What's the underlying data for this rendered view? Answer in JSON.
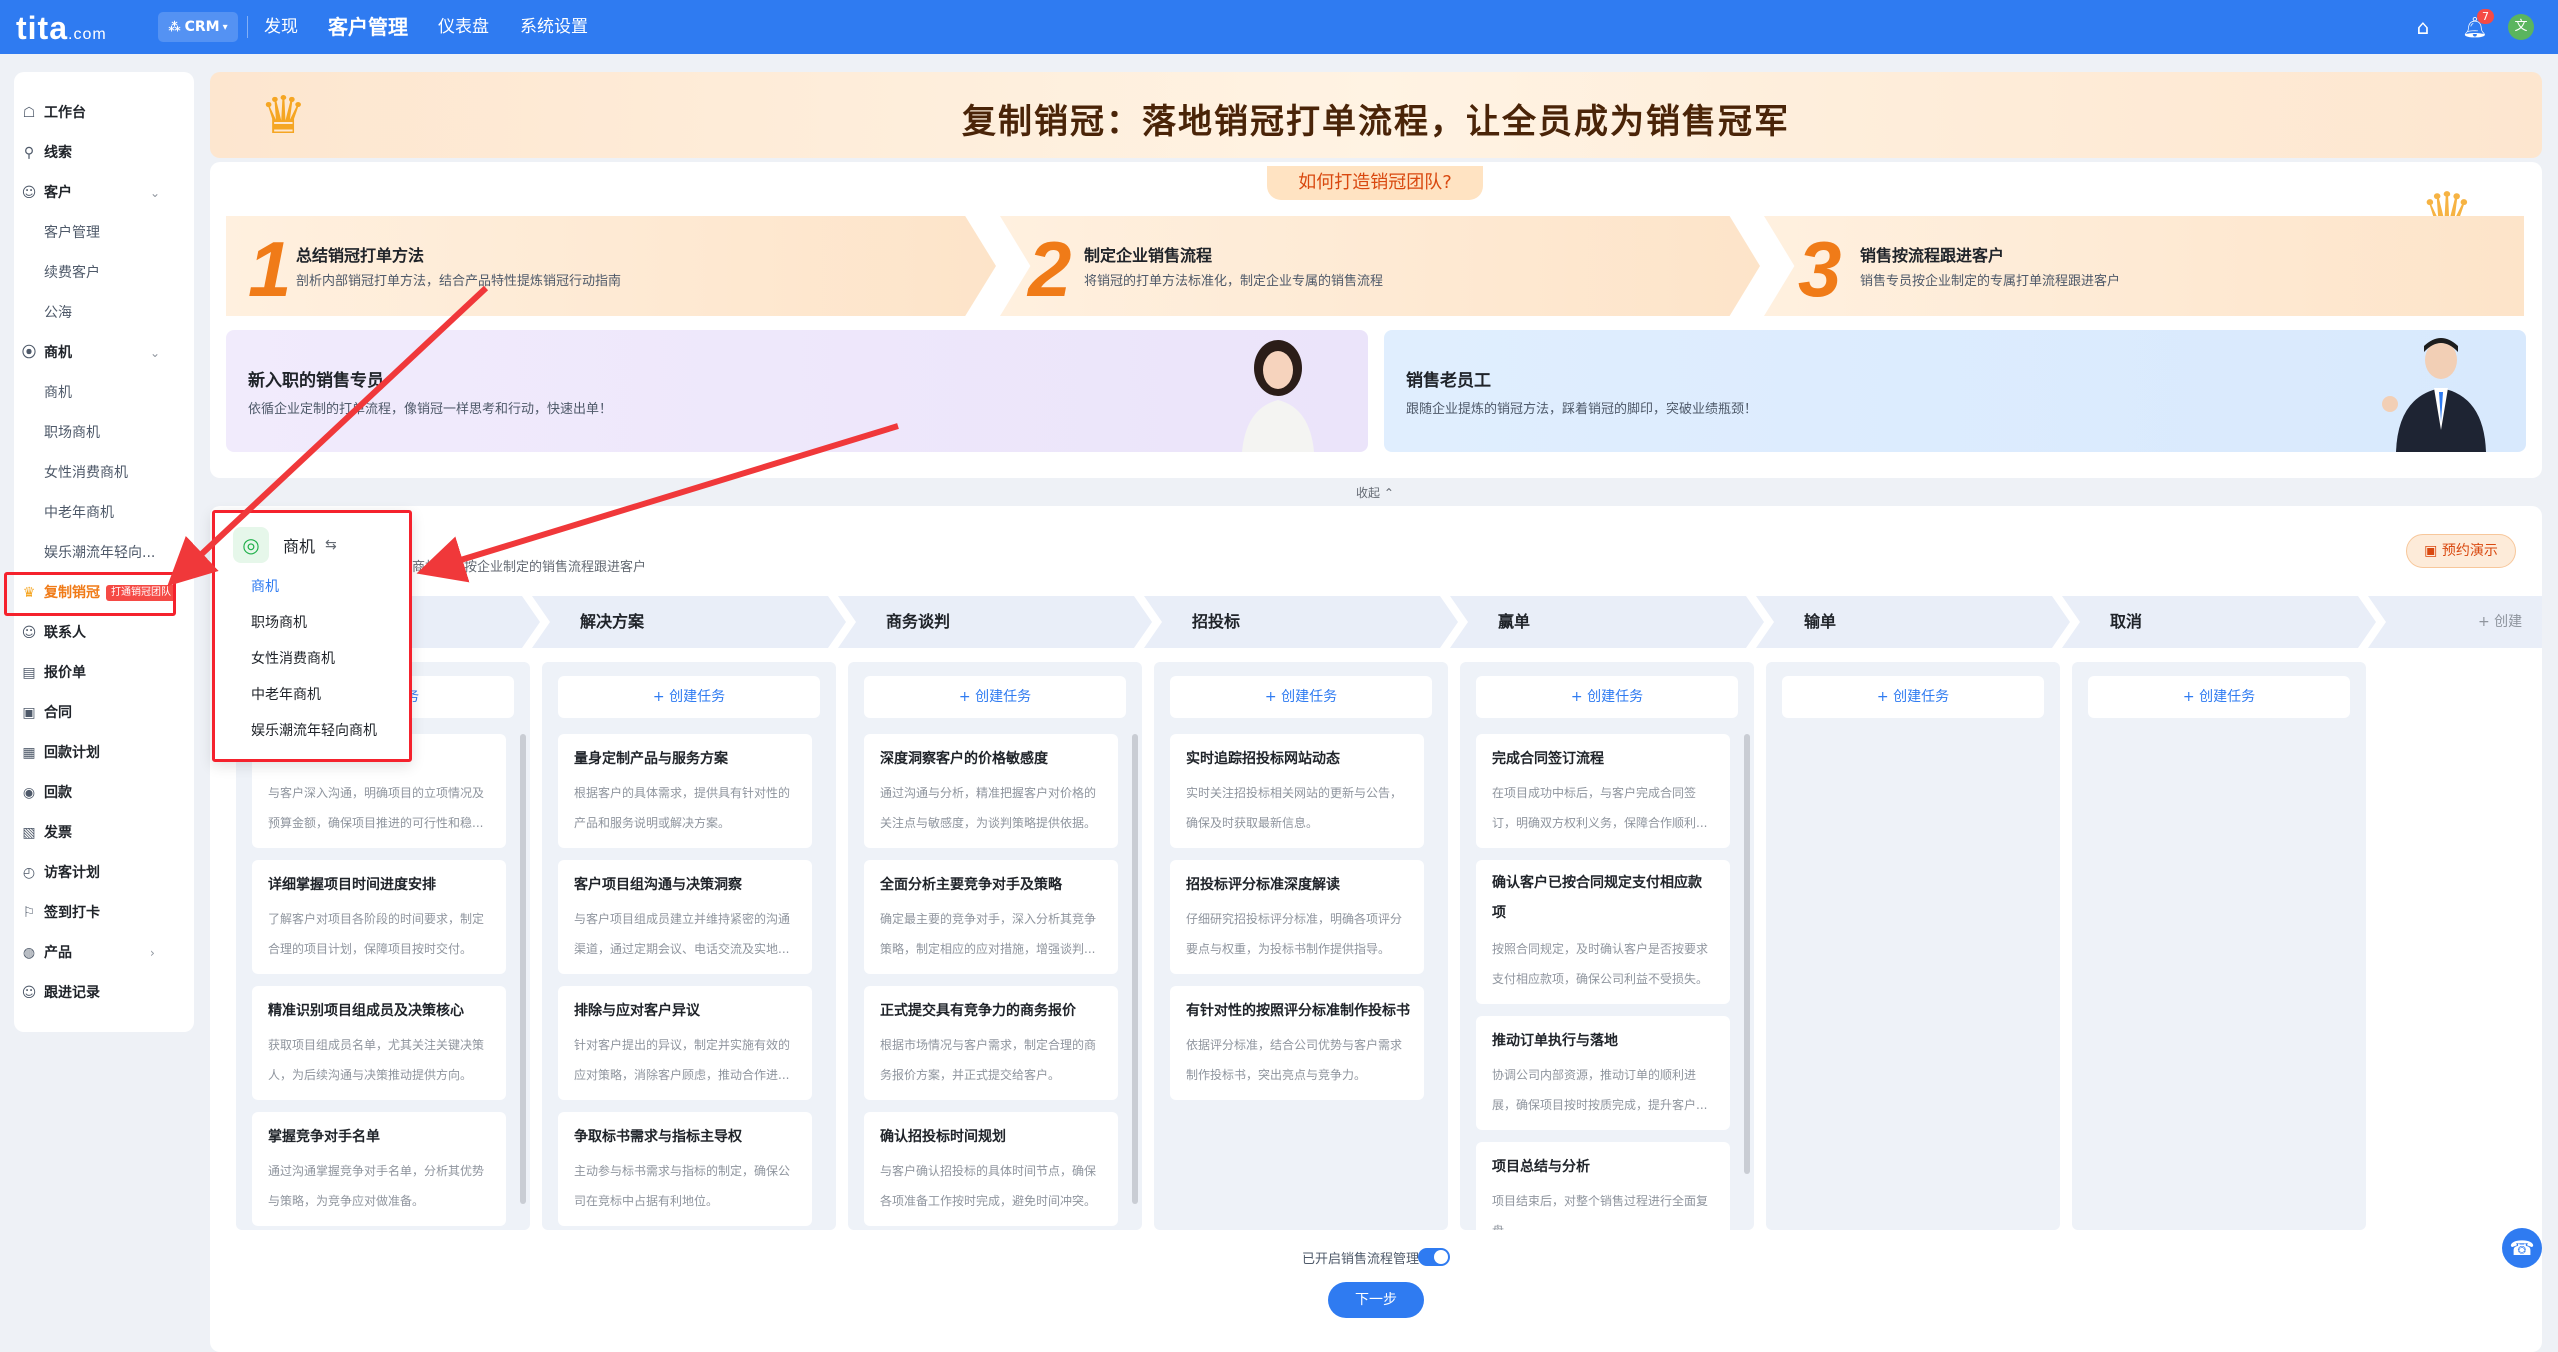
{
  "topbar": {
    "logo": "tita",
    "logo_suffix": ".com",
    "crm_label": "CRM",
    "nav": [
      "发现",
      "客户管理",
      "仪表盘",
      "系统设置"
    ],
    "notification_count": "7",
    "avatar_initial": "文"
  },
  "sidebar": {
    "items": [
      {
        "label": "工作台",
        "icon": "workbench-icon"
      },
      {
        "label": "线索",
        "icon": "leads-icon"
      },
      {
        "label": "客户",
        "icon": "customer-icon"
      },
      {
        "label": "客户管理"
      },
      {
        "label": "续费客户"
      },
      {
        "label": "公海"
      },
      {
        "label": "商机",
        "icon": "opportunity-icon"
      },
      {
        "label": "商机"
      },
      {
        "label": "职场商机"
      },
      {
        "label": "女性消费商机"
      },
      {
        "label": "中老年商机"
      },
      {
        "label": "娱乐潮流年轻向..."
      },
      {
        "label": "复制销冠",
        "tag": "打通销冠团队"
      },
      {
        "label": "联系人"
      },
      {
        "label": "报价单"
      },
      {
        "label": "合同"
      },
      {
        "label": "回款计划"
      },
      {
        "label": "回款"
      },
      {
        "label": "发票"
      },
      {
        "label": "访客计划"
      },
      {
        "label": "签到打卡"
      },
      {
        "label": "产品"
      },
      {
        "label": "跟进记录"
      }
    ]
  },
  "banner": {
    "title": "复制销冠：落地销冠打单流程，让全员成为销售冠军"
  },
  "intro": {
    "tag": "如何打造销冠团队?",
    "steps": [
      {
        "num": "1",
        "title": "总结销冠打单方法",
        "desc": "剖析内部销冠打单方法，结合产品特性提炼销冠行动指南"
      },
      {
        "num": "2",
        "title": "制定企业销售流程",
        "desc": "将销冠的打单方法标准化，制定企业专属的销售流程"
      },
      {
        "num": "3",
        "title": "销售按流程跟进客户",
        "desc": "销售专员按企业制定的专属打单流程跟进客户"
      }
    ],
    "cards": [
      {
        "title": "新入职的销售专员",
        "desc": "依循企业定制的打单流程，像销冠一样思考和行动，快速出单！"
      },
      {
        "title": "销售老员工",
        "desc": "跟随企业提炼的销冠方法，踩着销冠的脚印，突破业绩瓶颈！"
      }
    ],
    "collapse": "收起"
  },
  "pipeline": {
    "sub_desc": "商机时，按企业制定的销售流程跟进客户",
    "demo_button": "预约演示",
    "create_label": "+ 创建任务",
    "add_stage": "+ 创建",
    "stages": [
      {
        "name": "",
        "tasks": [
          {
            "title": "…",
            "desc": "与客户深入沟通，明确项目的立项情况及预算金额，确保项目推进的可行性和稳..."
          },
          {
            "title": "详细掌握项目时间进度安排",
            "desc": "了解客户对项目各阶段的时间要求，制定合理的项目计划，保障项目按时交付。"
          },
          {
            "title": "精准识别项目组成员及决策核心",
            "desc": "获取项目组成员名单，尤其关注关键决策人，为后续沟通与决策推动提供方向。"
          },
          {
            "title": "掌握竞争对手名单",
            "desc": "通过沟通掌握竞争对手名单，分析其优势与策略，为竞争应对做准备。"
          }
        ]
      },
      {
        "name": "解决方案",
        "tasks": [
          {
            "title": "量身定制产品与服务方案",
            "desc": "根据客户的具体需求，提供具有针对性的产品和服务说明或解决方案。"
          },
          {
            "title": "客户项目组沟通与决策洞察",
            "desc": "与客户项目组成员建立并维持紧密的沟通渠道，通过定期会议、电话交流及实地..."
          },
          {
            "title": "排除与应对客户异议",
            "desc": "针对客户提出的异议，制定并实施有效的应对策略，消除客户顾虑，推动合作进..."
          },
          {
            "title": "争取标书需求与指标主导权",
            "desc": "主动参与标书需求与指标的制定，确保公司在竞标中占据有利地位。"
          }
        ]
      },
      {
        "name": "商务谈判",
        "tasks": [
          {
            "title": "深度洞察客户的价格敏感度",
            "desc": "通过沟通与分析，精准把握客户对价格的关注点与敏感度，为谈判策略提供依据。"
          },
          {
            "title": "全面分析主要竞争对手及策略",
            "desc": "确定最主要的竞争对手，深入分析其竞争策略，制定相应的应对措施，增强谈判..."
          },
          {
            "title": "正式提交具有竞争力的商务报价",
            "desc": "根据市场情况与客户需求，制定合理的商务报价方案，并正式提交给客户。"
          },
          {
            "title": "确认招投标时间规划",
            "desc": "与客户确认招投标的具体时间节点，确保各项准备工作按时完成，避免时间冲突。"
          }
        ]
      },
      {
        "name": "招投标",
        "tasks": [
          {
            "title": "实时追踪招投标网站动态",
            "desc": "实时关注招投标相关网站的更新与公告，确保及时获取最新信息。"
          },
          {
            "title": "招投标评分标准深度解读",
            "desc": "仔细研究招投标评分标准，明确各项评分要点与权重，为投标书制作提供指导。"
          },
          {
            "title": "有针对性的按照评分标准制作投标书",
            "desc": "依据评分标准，结合公司优势与客户需求制作投标书，突出亮点与竞争力。"
          }
        ]
      },
      {
        "name": "赢单",
        "tasks": [
          {
            "title": "完成合同签订流程",
            "desc": "在项目成功中标后，与客户完成合同签订，明确双方权利义务，保障合作顺利..."
          },
          {
            "title": "确认客户已按合同规定支付相应款项",
            "desc": "按照合同规定，及时确认客户是否按要求支付相应款项，确保公司利益不受损失。"
          },
          {
            "title": "推动订单执行与落地",
            "desc": "协调公司内部资源，推动订单的顺利进展，确保项目按时按质完成，提升客户..."
          },
          {
            "title": "项目总结与分析",
            "desc": "项目结束后，对整个销售过程进行全面复盘"
          }
        ]
      },
      {
        "name": "输单",
        "tasks": []
      },
      {
        "name": "取消",
        "tasks": []
      }
    ],
    "toggle_label": "已开启销售流程管理",
    "next_button": "下一步"
  },
  "popup": {
    "title": "商机",
    "items": [
      "商机",
      "职场商机",
      "女性消费商机",
      "中老年商机",
      "娱乐潮流年轻向商机"
    ]
  }
}
